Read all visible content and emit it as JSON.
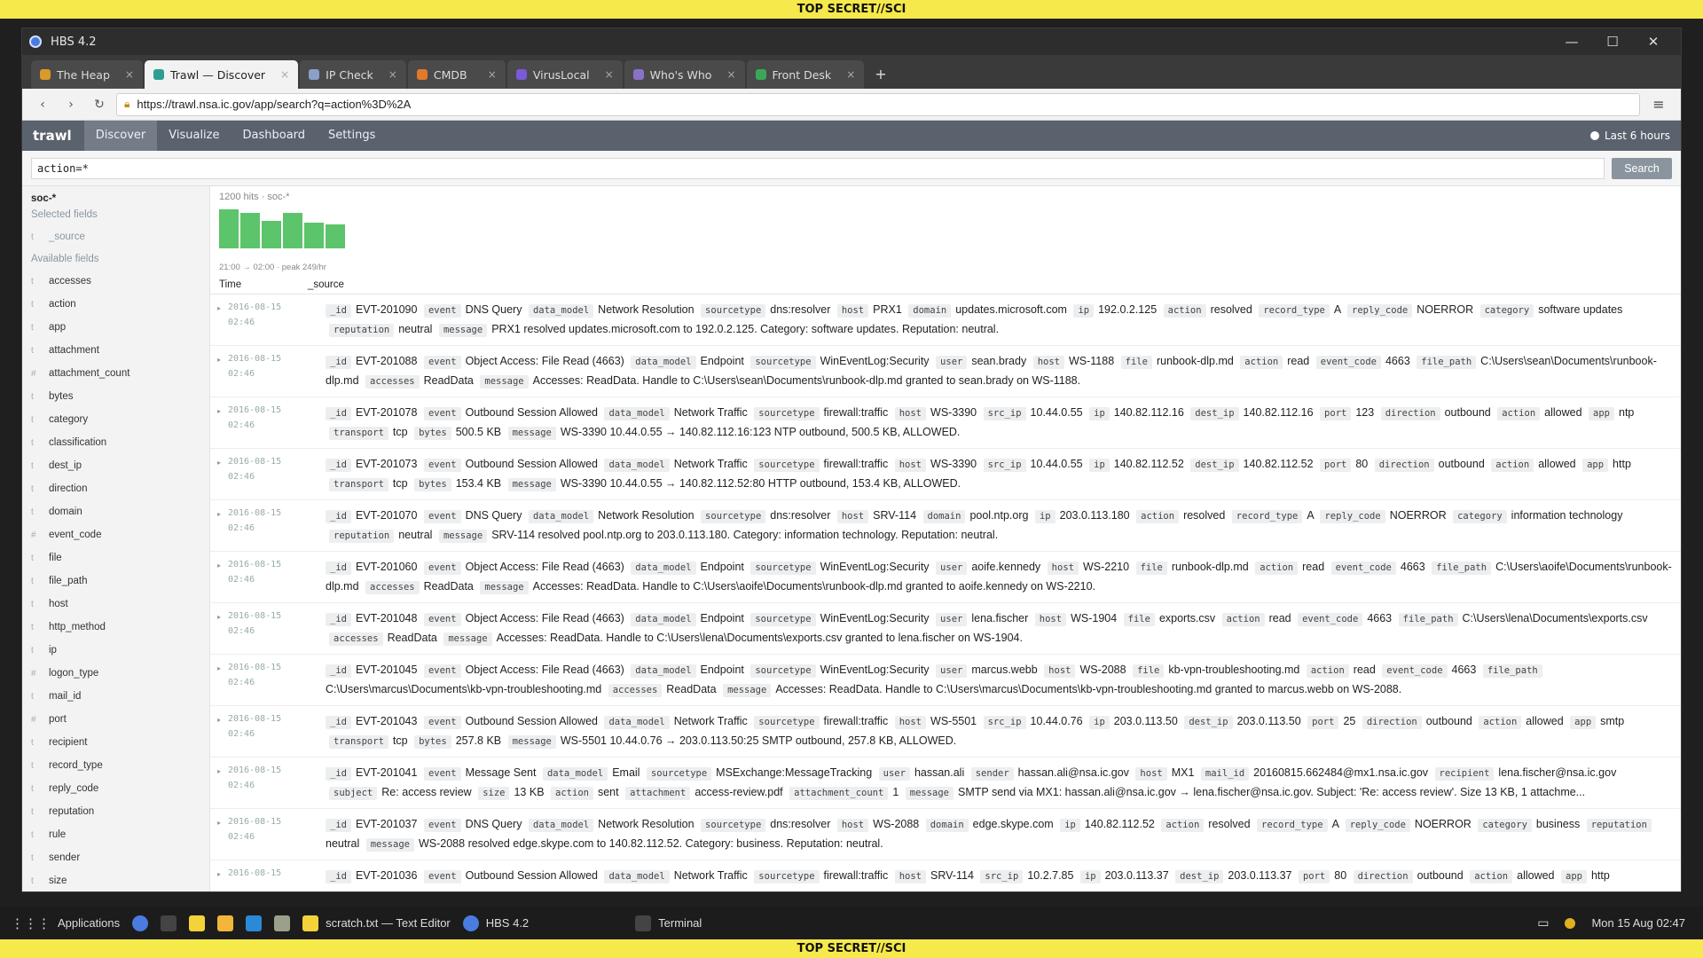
{
  "banner": {
    "top": "TOP SECRET//SCI",
    "bottom": "TOP SECRET//SCI"
  },
  "window": {
    "title": "HBS 4.2"
  },
  "tabs": [
    {
      "label": "The Heap",
      "color": "#d89a2a",
      "active": false
    },
    {
      "label": "Trawl — Discover",
      "color": "#2e9e94",
      "active": true
    },
    {
      "label": "IP Check",
      "color": "#8aa0c8",
      "active": false
    },
    {
      "label": "CMDB",
      "color": "#e07a2a",
      "active": false
    },
    {
      "label": "VirusLocal",
      "color": "#7a5ad8",
      "active": false
    },
    {
      "label": "Who's Who",
      "color": "#8a72c8",
      "active": false
    },
    {
      "label": "Front Desk",
      "color": "#3aa858",
      "active": false
    }
  ],
  "nav": {
    "url": "https://trawl.nsa.ic.gov/app/search?q=action%3D%2A"
  },
  "app": {
    "brand": "trawl",
    "menu": [
      "Discover",
      "Visualize",
      "Dashboard",
      "Settings"
    ],
    "timepicker": "Last 6 hours"
  },
  "query": {
    "value": "action=*",
    "search_label": "Search"
  },
  "sidebar": {
    "index": "soc-*",
    "selected_title": "Selected fields",
    "selected": [
      {
        "type": "t",
        "name": "_source"
      }
    ],
    "available_title": "Available fields",
    "fields": [
      {
        "type": "t",
        "name": "accesses"
      },
      {
        "type": "t",
        "name": "action"
      },
      {
        "type": "t",
        "name": "app"
      },
      {
        "type": "t",
        "name": "attachment"
      },
      {
        "type": "#",
        "name": "attachment_count"
      },
      {
        "type": "t",
        "name": "bytes"
      },
      {
        "type": "t",
        "name": "category"
      },
      {
        "type": "t",
        "name": "classification"
      },
      {
        "type": "t",
        "name": "dest_ip"
      },
      {
        "type": "t",
        "name": "direction"
      },
      {
        "type": "t",
        "name": "domain"
      },
      {
        "type": "#",
        "name": "event_code"
      },
      {
        "type": "t",
        "name": "file"
      },
      {
        "type": "t",
        "name": "file_path"
      },
      {
        "type": "t",
        "name": "host"
      },
      {
        "type": "t",
        "name": "http_method"
      },
      {
        "type": "t",
        "name": "ip"
      },
      {
        "type": "#",
        "name": "logon_type"
      },
      {
        "type": "t",
        "name": "mail_id"
      },
      {
        "type": "#",
        "name": "port"
      },
      {
        "type": "t",
        "name": "recipient"
      },
      {
        "type": "t",
        "name": "record_type"
      },
      {
        "type": "t",
        "name": "reply_code"
      },
      {
        "type": "t",
        "name": "reputation"
      },
      {
        "type": "t",
        "name": "rule"
      },
      {
        "type": "t",
        "name": "sender"
      },
      {
        "type": "t",
        "name": "size"
      }
    ]
  },
  "results": {
    "hits": "1200 hits · soc-*",
    "histogram_caption": "21:00 → 02:00 · peak 249/hr",
    "histogram": [
      0.95,
      0.86,
      0.68,
      0.87,
      0.63,
      0.58
    ],
    "col_time": "Time",
    "col_source": "_source",
    "rows": [
      {
        "date": "2016-08-15",
        "time": "02:46",
        "fields": [
          [
            "_id",
            "EVT-201090"
          ],
          [
            "event",
            "DNS Query"
          ],
          [
            "data_model",
            "Network Resolution"
          ],
          [
            "sourcetype",
            "dns:resolver"
          ],
          [
            "host",
            "PRX1"
          ],
          [
            "domain",
            "updates.microsoft.com"
          ],
          [
            "ip",
            "192.0.2.125"
          ],
          [
            "action",
            "resolved"
          ],
          [
            "record_type",
            "A"
          ],
          [
            "reply_code",
            "NOERROR"
          ],
          [
            "category",
            "software updates"
          ],
          [
            "reputation",
            "neutral"
          ],
          [
            "message",
            "PRX1 resolved updates.microsoft.com to 192.0.2.125. Category: software updates. Reputation: neutral."
          ]
        ]
      },
      {
        "date": "2016-08-15",
        "time": "02:46",
        "fields": [
          [
            "_id",
            "EVT-201088"
          ],
          [
            "event",
            "Object Access: File Read (4663)"
          ],
          [
            "data_model",
            "Endpoint"
          ],
          [
            "sourcetype",
            "WinEventLog:Security"
          ],
          [
            "user",
            "sean.brady"
          ],
          [
            "host",
            "WS-1188"
          ],
          [
            "file",
            "runbook-dlp.md"
          ],
          [
            "action",
            "read"
          ],
          [
            "event_code",
            "4663"
          ],
          [
            "file_path",
            "C:\\Users\\sean\\Documents\\runbook-dlp.md"
          ],
          [
            "accesses",
            "ReadData"
          ],
          [
            "message",
            "Accesses: ReadData. Handle to C:\\Users\\sean\\Documents\\runbook-dlp.md granted to sean.brady on WS-1188."
          ]
        ]
      },
      {
        "date": "2016-08-15",
        "time": "02:46",
        "fields": [
          [
            "_id",
            "EVT-201078"
          ],
          [
            "event",
            "Outbound Session Allowed"
          ],
          [
            "data_model",
            "Network Traffic"
          ],
          [
            "sourcetype",
            "firewall:traffic"
          ],
          [
            "host",
            "WS-3390"
          ],
          [
            "src_ip",
            "10.44.0.55"
          ],
          [
            "ip",
            "140.82.112.16"
          ],
          [
            "dest_ip",
            "140.82.112.16"
          ],
          [
            "port",
            "123"
          ],
          [
            "direction",
            "outbound"
          ],
          [
            "action",
            "allowed"
          ],
          [
            "app",
            "ntp"
          ],
          [
            "transport",
            "tcp"
          ],
          [
            "bytes",
            "500.5 KB"
          ],
          [
            "message",
            "WS-3390 10.44.0.55 → 140.82.112.16:123 NTP outbound, 500.5 KB, ALLOWED."
          ]
        ]
      },
      {
        "date": "2016-08-15",
        "time": "02:46",
        "fields": [
          [
            "_id",
            "EVT-201073"
          ],
          [
            "event",
            "Outbound Session Allowed"
          ],
          [
            "data_model",
            "Network Traffic"
          ],
          [
            "sourcetype",
            "firewall:traffic"
          ],
          [
            "host",
            "WS-3390"
          ],
          [
            "src_ip",
            "10.44.0.55"
          ],
          [
            "ip",
            "140.82.112.52"
          ],
          [
            "dest_ip",
            "140.82.112.52"
          ],
          [
            "port",
            "80"
          ],
          [
            "direction",
            "outbound"
          ],
          [
            "action",
            "allowed"
          ],
          [
            "app",
            "http"
          ],
          [
            "transport",
            "tcp"
          ],
          [
            "bytes",
            "153.4 KB"
          ],
          [
            "message",
            "WS-3390 10.44.0.55 → 140.82.112.52:80 HTTP outbound, 153.4 KB, ALLOWED."
          ]
        ]
      },
      {
        "date": "2016-08-15",
        "time": "02:46",
        "fields": [
          [
            "_id",
            "EVT-201070"
          ],
          [
            "event",
            "DNS Query"
          ],
          [
            "data_model",
            "Network Resolution"
          ],
          [
            "sourcetype",
            "dns:resolver"
          ],
          [
            "host",
            "SRV-114"
          ],
          [
            "domain",
            "pool.ntp.org"
          ],
          [
            "ip",
            "203.0.113.180"
          ],
          [
            "action",
            "resolved"
          ],
          [
            "record_type",
            "A"
          ],
          [
            "reply_code",
            "NOERROR"
          ],
          [
            "category",
            "information technology"
          ],
          [
            "reputation",
            "neutral"
          ],
          [
            "message",
            "SRV-114 resolved pool.ntp.org to 203.0.113.180. Category: information technology. Reputation: neutral."
          ]
        ]
      },
      {
        "date": "2016-08-15",
        "time": "02:46",
        "fields": [
          [
            "_id",
            "EVT-201060"
          ],
          [
            "event",
            "Object Access: File Read (4663)"
          ],
          [
            "data_model",
            "Endpoint"
          ],
          [
            "sourcetype",
            "WinEventLog:Security"
          ],
          [
            "user",
            "aoife.kennedy"
          ],
          [
            "host",
            "WS-2210"
          ],
          [
            "file",
            "runbook-dlp.md"
          ],
          [
            "action",
            "read"
          ],
          [
            "event_code",
            "4663"
          ],
          [
            "file_path",
            "C:\\Users\\aoife\\Documents\\runbook-dlp.md"
          ],
          [
            "accesses",
            "ReadData"
          ],
          [
            "message",
            "Accesses: ReadData. Handle to C:\\Users\\aoife\\Documents\\runbook-dlp.md granted to aoife.kennedy on WS-2210."
          ]
        ]
      },
      {
        "date": "2016-08-15",
        "time": "02:46",
        "fields": [
          [
            "_id",
            "EVT-201048"
          ],
          [
            "event",
            "Object Access: File Read (4663)"
          ],
          [
            "data_model",
            "Endpoint"
          ],
          [
            "sourcetype",
            "WinEventLog:Security"
          ],
          [
            "user",
            "lena.fischer"
          ],
          [
            "host",
            "WS-1904"
          ],
          [
            "file",
            "exports.csv"
          ],
          [
            "action",
            "read"
          ],
          [
            "event_code",
            "4663"
          ],
          [
            "file_path",
            "C:\\Users\\lena\\Documents\\exports.csv"
          ],
          [
            "accesses",
            "ReadData"
          ],
          [
            "message",
            "Accesses: ReadData. Handle to C:\\Users\\lena\\Documents\\exports.csv granted to lena.fischer on WS-1904."
          ]
        ]
      },
      {
        "date": "2016-08-15",
        "time": "02:46",
        "fields": [
          [
            "_id",
            "EVT-201045"
          ],
          [
            "event",
            "Object Access: File Read (4663)"
          ],
          [
            "data_model",
            "Endpoint"
          ],
          [
            "sourcetype",
            "WinEventLog:Security"
          ],
          [
            "user",
            "marcus.webb"
          ],
          [
            "host",
            "WS-2088"
          ],
          [
            "file",
            "kb-vpn-troubleshooting.md"
          ],
          [
            "action",
            "read"
          ],
          [
            "event_code",
            "4663"
          ],
          [
            "file_path",
            "C:\\Users\\marcus\\Documents\\kb-vpn-troubleshooting.md"
          ],
          [
            "accesses",
            "ReadData"
          ],
          [
            "message",
            "Accesses: ReadData. Handle to C:\\Users\\marcus\\Documents\\kb-vpn-troubleshooting.md granted to marcus.webb on WS-2088."
          ]
        ]
      },
      {
        "date": "2016-08-15",
        "time": "02:46",
        "fields": [
          [
            "_id",
            "EVT-201043"
          ],
          [
            "event",
            "Outbound Session Allowed"
          ],
          [
            "data_model",
            "Network Traffic"
          ],
          [
            "sourcetype",
            "firewall:traffic"
          ],
          [
            "host",
            "WS-5501"
          ],
          [
            "src_ip",
            "10.44.0.76"
          ],
          [
            "ip",
            "203.0.113.50"
          ],
          [
            "dest_ip",
            "203.0.113.50"
          ],
          [
            "port",
            "25"
          ],
          [
            "direction",
            "outbound"
          ],
          [
            "action",
            "allowed"
          ],
          [
            "app",
            "smtp"
          ],
          [
            "transport",
            "tcp"
          ],
          [
            "bytes",
            "257.8 KB"
          ],
          [
            "message",
            "WS-5501 10.44.0.76 → 203.0.113.50:25 SMTP outbound, 257.8 KB, ALLOWED."
          ]
        ]
      },
      {
        "date": "2016-08-15",
        "time": "02:46",
        "fields": [
          [
            "_id",
            "EVT-201041"
          ],
          [
            "event",
            "Message Sent"
          ],
          [
            "data_model",
            "Email"
          ],
          [
            "sourcetype",
            "MSExchange:MessageTracking"
          ],
          [
            "user",
            "hassan.ali"
          ],
          [
            "sender",
            "hassan.ali@nsa.ic.gov"
          ],
          [
            "host",
            "MX1"
          ],
          [
            "mail_id",
            "20160815.662484@mx1.nsa.ic.gov"
          ],
          [
            "recipient",
            "lena.fischer@nsa.ic.gov"
          ],
          [
            "subject",
            "Re: access review"
          ],
          [
            "size",
            "13 KB"
          ],
          [
            "action",
            "sent"
          ],
          [
            "attachment",
            "access-review.pdf"
          ],
          [
            "attachment_count",
            "1"
          ],
          [
            "message",
            "SMTP send via MX1: hassan.ali@nsa.ic.gov → lena.fischer@nsa.ic.gov. Subject: 'Re: access review'. Size 13 KB, 1 attachme..."
          ]
        ]
      },
      {
        "date": "2016-08-15",
        "time": "02:46",
        "fields": [
          [
            "_id",
            "EVT-201037"
          ],
          [
            "event",
            "DNS Query"
          ],
          [
            "data_model",
            "Network Resolution"
          ],
          [
            "sourcetype",
            "dns:resolver"
          ],
          [
            "host",
            "WS-2088"
          ],
          [
            "domain",
            "edge.skype.com"
          ],
          [
            "ip",
            "140.82.112.52"
          ],
          [
            "action",
            "resolved"
          ],
          [
            "record_type",
            "A"
          ],
          [
            "reply_code",
            "NOERROR"
          ],
          [
            "category",
            "business"
          ],
          [
            "reputation",
            "neutral"
          ],
          [
            "message",
            "WS-2088 resolved edge.skype.com to 140.82.112.52. Category: business. Reputation: neutral."
          ]
        ]
      },
      {
        "date": "2016-08-15",
        "time": "",
        "fields": [
          [
            "_id",
            "EVT-201036"
          ],
          [
            "event",
            "Outbound Session Allowed"
          ],
          [
            "data_model",
            "Network Traffic"
          ],
          [
            "sourcetype",
            "firewall:traffic"
          ],
          [
            "host",
            "SRV-114"
          ],
          [
            "src_ip",
            "10.2.7.85"
          ],
          [
            "ip",
            "203.0.113.37"
          ],
          [
            "dest_ip",
            "203.0.113.37"
          ],
          [
            "port",
            "80"
          ],
          [
            "direction",
            "outbound"
          ],
          [
            "action",
            "allowed"
          ],
          [
            "app",
            "http"
          ]
        ]
      }
    ]
  },
  "taskbar": {
    "apps_label": "Applications",
    "editor_label": "scratch.txt — Text Editor",
    "browser_label": "HBS 4.2",
    "terminal_label": "Terminal",
    "clock": "Mon 15 Aug  02:47"
  }
}
